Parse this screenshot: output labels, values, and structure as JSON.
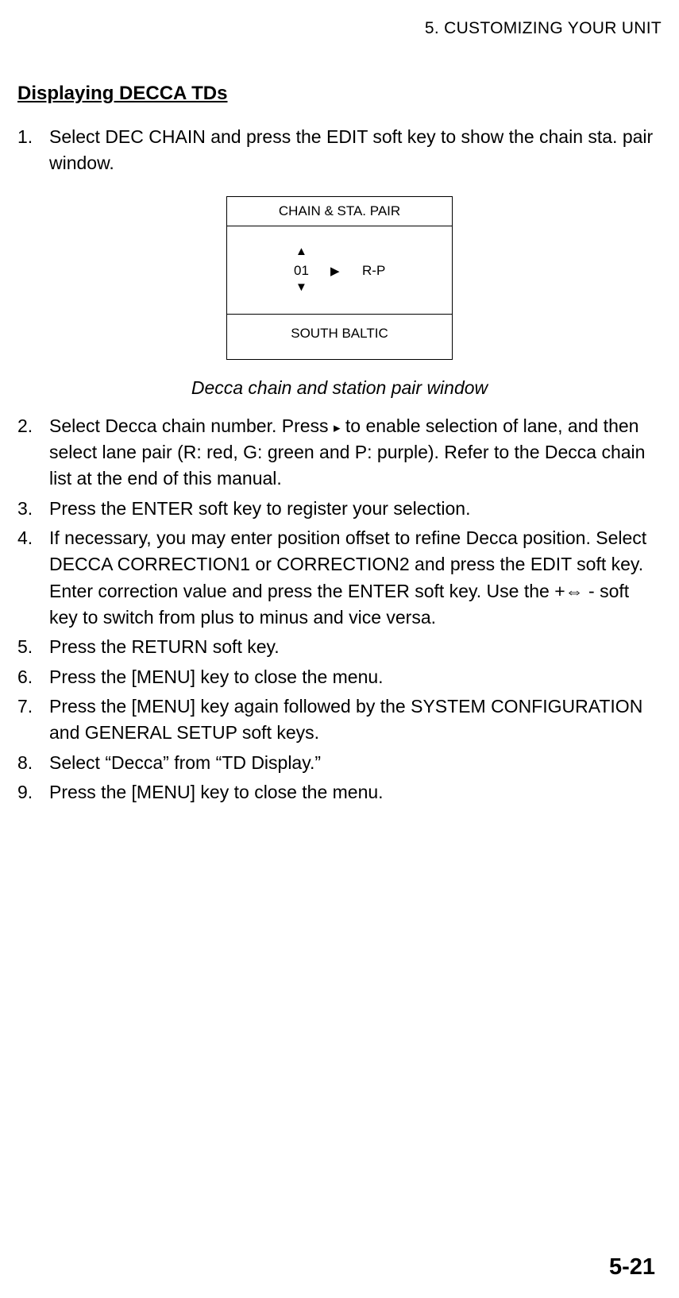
{
  "header": "5. CUSTOMIZING YOUR UNIT",
  "section_title": "Displaying DECCA TDs",
  "steps": {
    "s1": "Select DEC CHAIN and press the EDIT soft key to show the chain sta. pair window.",
    "s2a": "Select Decca chain number. Press ",
    "s2b": " to enable selection of lane, and then select lane pair (R: red, G: green and P: purple). Refer to the Decca chain list at the end of this manual.",
    "s3": "Press the ENTER soft key to register your selection.",
    "s4a": "If necessary, you may enter position offset to refine Decca position. Select DECCA CORRECTION1 or CORRECTION2 and press the EDIT soft key. Enter correction value and press the ENTER soft key. Use the +",
    "s4b": " - soft key to switch from plus to minus and vice versa.",
    "s5": "Press the RETURN soft key.",
    "s6": "Press the [MENU] key to close the menu.",
    "s7": "Press the [MENU] key again followed by the SYSTEM CONFIGURATION and GENERAL SETUP soft keys.",
    "s8": "Select “Decca” from “TD Display.”",
    "s9": "Press the [MENU] key to close the menu."
  },
  "figure": {
    "header": "CHAIN & STA. PAIR",
    "chain_num": "01",
    "lane_pair": "R-P",
    "footer": "SOUTH BALTIC",
    "caption": "Decca chain and station pair window"
  },
  "page_number": "5-21"
}
